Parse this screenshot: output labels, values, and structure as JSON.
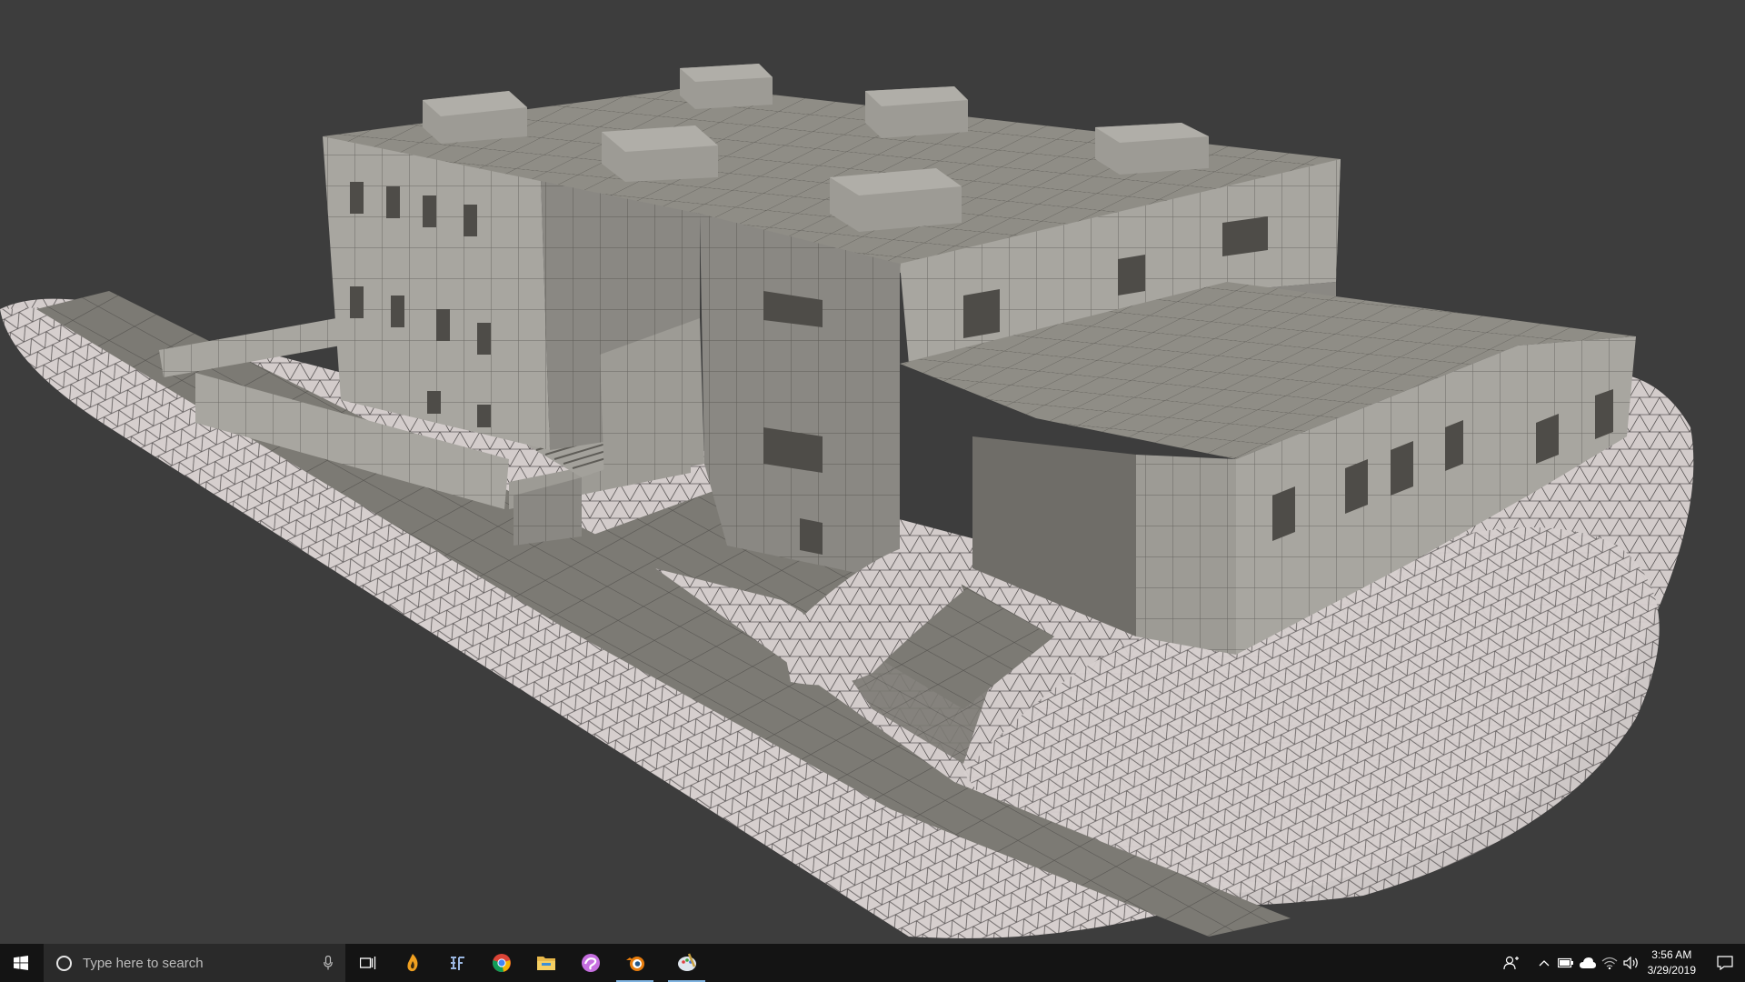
{
  "viewport": {
    "background_color": "#3d3d3d",
    "scene": "3d-wireframe-building-model"
  },
  "taskbar": {
    "start_icon": "windows-logo-icon",
    "search": {
      "placeholder": "Type here to search",
      "icon": "cortana-circle-icon",
      "mic_icon": "microphone-icon"
    },
    "apps": [
      {
        "name": "task-view",
        "icon": "task-view-icon",
        "active": false
      },
      {
        "name": "app-flame",
        "icon": "flame-app-icon",
        "active": false
      },
      {
        "name": "app-sf",
        "icon": "sf-app-icon",
        "active": false
      },
      {
        "name": "chrome",
        "icon": "chrome-icon",
        "active": false
      },
      {
        "name": "file-explorer",
        "icon": "folder-icon",
        "active": false
      },
      {
        "name": "app-swirl",
        "icon": "swirl-app-icon",
        "active": false
      },
      {
        "name": "blender",
        "icon": "blender-icon",
        "active": true
      },
      {
        "name": "app-paint",
        "icon": "paint-palette-icon",
        "active": true
      }
    ],
    "tray": {
      "icons": [
        "people-icon",
        "chevron-up-icon",
        "battery-icon",
        "cloud-icon",
        "wifi-icon",
        "volume-icon"
      ],
      "time": "3:56 AM",
      "date": "3/29/2019",
      "notification_icon": "action-center-icon"
    },
    "accent_color": "#7fb3e0"
  }
}
